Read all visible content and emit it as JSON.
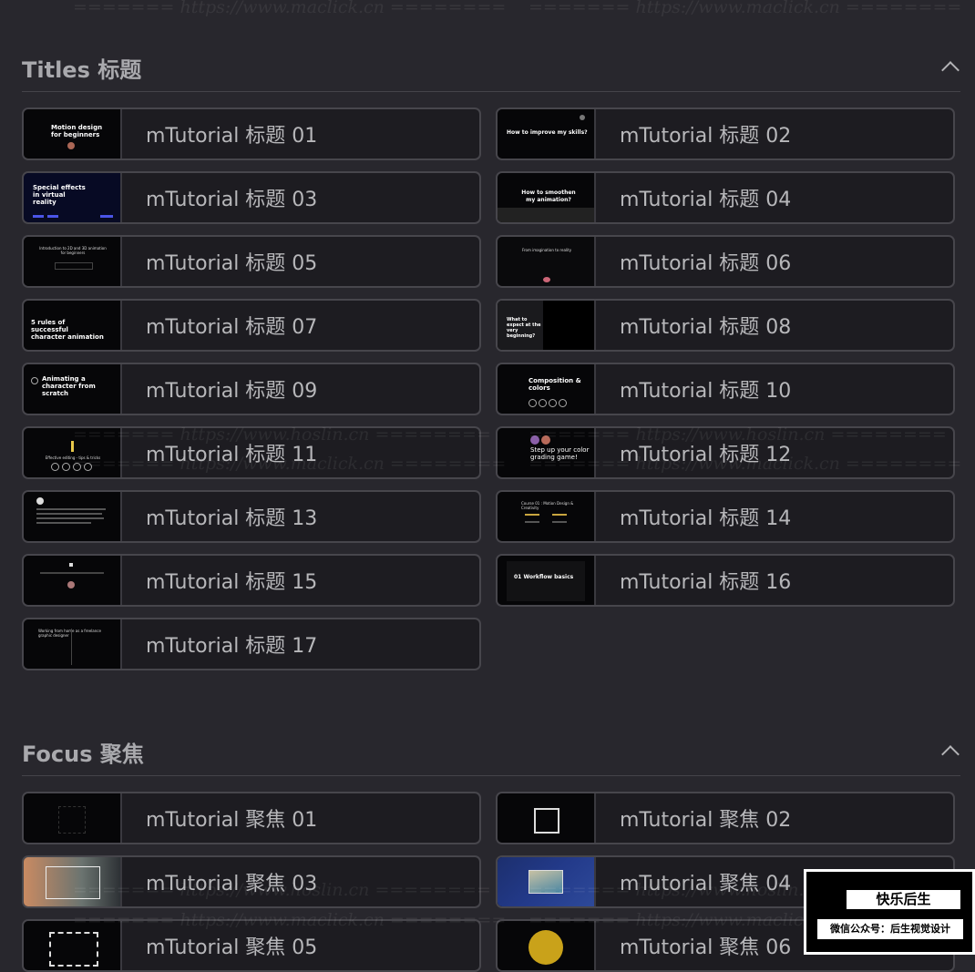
{
  "sections": [
    {
      "title": "Titles 标题",
      "items": [
        {
          "label": "mTutorial 标题 01",
          "thumb_text": "Motion design for beginners"
        },
        {
          "label": "mTutorial 标题 02",
          "thumb_text": "How to improve my skills?"
        },
        {
          "label": "mTutorial 标题 03",
          "thumb_text": "Special effects in virtual reality"
        },
        {
          "label": "mTutorial 标题 04",
          "thumb_text": "How to smoothen my animation?"
        },
        {
          "label": "mTutorial 标题 05",
          "thumb_text": "Introduction to 2D and 3D animation for beginners"
        },
        {
          "label": "mTutorial 标题 06",
          "thumb_text": "From imagination to reality"
        },
        {
          "label": "mTutorial 标题 07",
          "thumb_text": "5 rules of successful character animation"
        },
        {
          "label": "mTutorial 标题 08",
          "thumb_text": "What to expect at the very beginning?"
        },
        {
          "label": "mTutorial 标题 09",
          "thumb_text": "Animating a character from scratch"
        },
        {
          "label": "mTutorial 标题 10",
          "thumb_text": "Composition & colors"
        },
        {
          "label": "mTutorial 标题 11",
          "thumb_text": "Effective editing - tips & tricks"
        },
        {
          "label": "mTutorial 标题 12",
          "thumb_text": "Step up your color grading game!"
        },
        {
          "label": "mTutorial 标题 13",
          "thumb_text": ""
        },
        {
          "label": "mTutorial 标题 14",
          "thumb_text": "Course 01 : Motion Design & Creativity"
        },
        {
          "label": "mTutorial 标题 15",
          "thumb_text": ""
        },
        {
          "label": "mTutorial 标题 16",
          "thumb_text": "01 Workflow basics"
        },
        {
          "label": "mTutorial 标题 17",
          "thumb_text": "Working from home as a freelance graphic designer"
        }
      ]
    },
    {
      "title": "Focus 聚焦",
      "items": [
        {
          "label": "mTutorial 聚焦 01"
        },
        {
          "label": "mTutorial 聚焦 02"
        },
        {
          "label": "mTutorial 聚焦 03"
        },
        {
          "label": "mTutorial 聚焦 04"
        },
        {
          "label": "mTutorial 聚焦 05"
        },
        {
          "label": "mTutorial 聚焦 06"
        }
      ]
    }
  ],
  "watermarks": {
    "maclick": "======= https://www.maclick.cn ========",
    "hoslin": "======= https://www.hoslin.cn ========"
  },
  "badge": {
    "top": "快乐后生",
    "bottom": "微信公众号：后生视觉设计"
  },
  "colors": {
    "background": "#28272d",
    "item_background": "#1d1c21",
    "item_border": "#47464c"
  }
}
